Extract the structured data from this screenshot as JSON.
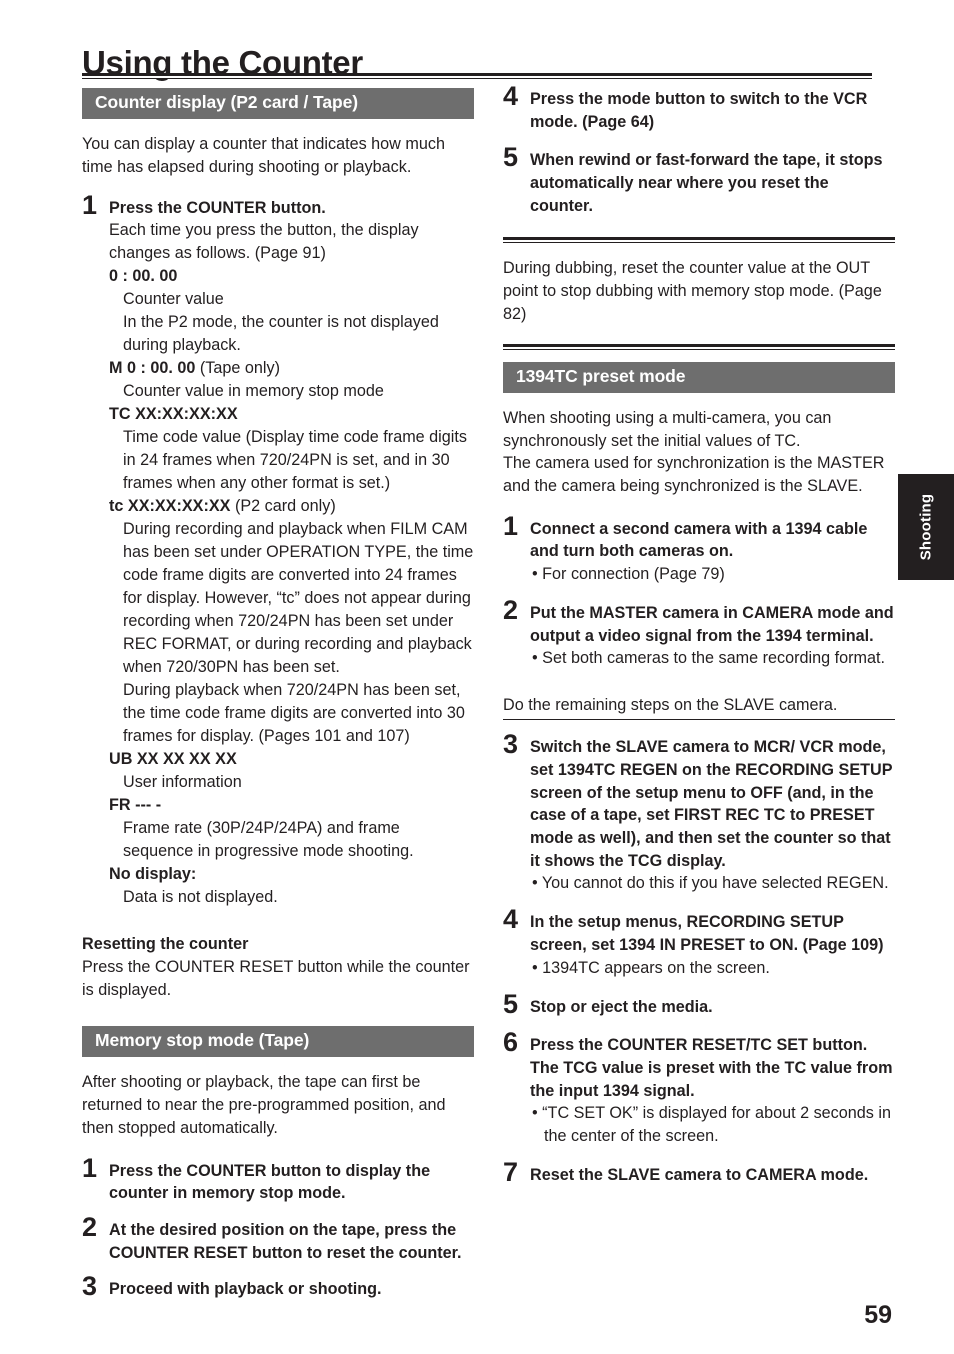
{
  "document": {
    "title": "Using the Counter",
    "page_number": "59",
    "side_tab_label": "Shooting",
    "accent_bar_color": "#6e6e6e",
    "text_color": "#231f20",
    "tab_color": "#231f20"
  },
  "left_column": {
    "section_1": {
      "bar_label": "Counter display (P2 card / Tape)",
      "intro": "You can display a counter that indicates how much time has elapsed during shooting or playback.",
      "step": {
        "number": "1",
        "title": "Press the COUNTER button.",
        "body": "Each time you press the button, the display changes as follows. (Page 91)"
      },
      "definitions": [
        {
          "term": "0 : 00. 00",
          "term_suffix": "",
          "lines": [
            "Counter value",
            "In the P2 mode, the counter is not displayed during playback."
          ]
        },
        {
          "term": "M 0 : 00. 00",
          "term_suffix": " (Tape only)",
          "lines": [
            "Counter value in memory stop mode"
          ]
        },
        {
          "term": "TC XX:XX:XX:XX",
          "term_suffix": "",
          "lines": [
            "Time code value (Display time code frame digits in 24 frames when 720/24PN is set, and in 30 frames when any other format is set.)"
          ]
        },
        {
          "term": "tc XX:XX:XX:XX",
          "term_suffix": " (P2 card only)",
          "lines": [
            "During recording and playback when FILM CAM has been set under OPERATION TYPE, the time code frame digits are converted into 24 frames for display. However, “tc” does not appear during recording when 720/24PN has been set under REC FORMAT, or during recording and playback when 720/30PN has been set.",
            "During playback when 720/24PN has been set, the time code frame digits are converted into 30 frames for display. (Pages 101 and 107)"
          ]
        },
        {
          "term": "UB XX XX XX XX",
          "term_suffix": "",
          "lines": [
            "User information"
          ]
        },
        {
          "term": "FR --- -",
          "term_suffix": "",
          "lines": [
            "Frame rate (30P/24P/24PA) and frame sequence in progressive mode shooting."
          ]
        },
        {
          "term": "No display:",
          "term_suffix": "",
          "lines": [
            "Data is not displayed."
          ]
        }
      ],
      "reset_heading": "Resetting the counter",
      "reset_body": "Press the COUNTER RESET button while the counter is displayed."
    },
    "section_2": {
      "bar_label": "Memory stop mode (Tape)",
      "intro": "After shooting or playback, the tape can first be returned to near the pre-programmed position, and then stopped automatically.",
      "steps": [
        {
          "number": "1",
          "title": "Press the COUNTER button to display the counter in memory stop mode."
        },
        {
          "number": "2",
          "title": "At the desired position on the tape, press the COUNTER RESET button to reset the counter."
        },
        {
          "number": "3",
          "title": "Proceed with playback or shooting."
        }
      ]
    }
  },
  "right_column": {
    "continued_steps": [
      {
        "number": "4",
        "title": "Press the mode button to switch to the VCR mode. (Page 64)"
      },
      {
        "number": "5",
        "title": "When rewind or fast-forward the tape, it stops automatically near where you reset the counter."
      }
    ],
    "dubbing_note": "During dubbing, reset the counter value at the OUT point to stop dubbing with memory stop mode. (Page 82)",
    "section_3": {
      "bar_label": "1394TC preset mode",
      "intro": "When shooting using a multi-camera, you can synchronously set the initial values of TC.\nThe camera used for synchronization is the MASTER and the camera being synchronized is the SLAVE.",
      "intro_line_1": "When shooting using a multi-camera, you can synchronously set the initial values of TC.",
      "intro_line_2": "The camera used for synchronization is the MASTER and the camera being synchronized is the SLAVE.",
      "steps_before_note": [
        {
          "number": "1",
          "title": "Connect a second camera with a 1394 cable and turn both cameras on.",
          "bullets": [
            "• For connection (Page 79)"
          ]
        },
        {
          "number": "2",
          "title": "Put the MASTER camera in CAMERA mode and output a video signal from the 1394 terminal.",
          "bullets": [
            "• Set both cameras to the same recording format."
          ]
        }
      ],
      "slave_note": "Do the remaining steps on the SLAVE camera.",
      "steps_after_note": [
        {
          "number": "3",
          "title": "Switch the SLAVE camera to MCR/ VCR mode, set 1394TC REGEN on the RECORDING SETUP screen of the setup menu to OFF (and, in the case of a tape, set FIRST REC TC to PRESET mode as well), and then set the counter so that it shows the TCG display.",
          "bullets": [
            "• You cannot do this if you have selected REGEN."
          ]
        },
        {
          "number": "4",
          "title": "In the setup menus, RECORDING SETUP screen, set 1394 IN PRESET to ON. (Page 109)",
          "bullets": [
            "• 1394TC appears on the screen."
          ]
        },
        {
          "number": "5",
          "title": "Stop or eject the media.",
          "bullets": []
        },
        {
          "number": "6",
          "title": "Press the COUNTER RESET/TC SET button. The TCG value is preset with the TC value from the input 1394 signal.",
          "bullets": [
            "• “TC SET OK” is displayed for about 2 seconds in the center of the screen."
          ]
        },
        {
          "number": "7",
          "title": "Reset the SLAVE camera to CAMERA mode.",
          "bullets": []
        }
      ]
    }
  }
}
